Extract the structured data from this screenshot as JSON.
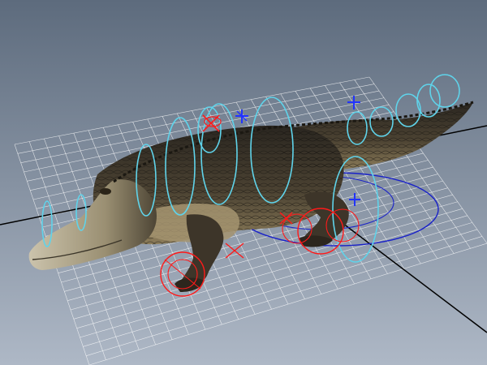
{
  "viewport": {
    "background_top": "#5d6b7d",
    "background_bottom": "#aeb8c6"
  },
  "scene": {
    "grid": {
      "line_color": "#ffffff",
      "axis_color": "#000000"
    },
    "rig": {
      "ik_color": "#ff1a1a",
      "fk_color": "#5fd3ea",
      "root_color": "#1a22c8",
      "pole_color": "#2233ff"
    },
    "model": {
      "name": "alligator",
      "skin_dark": "#2a2620",
      "skin_mid": "#4b4232",
      "belly": "#a59470",
      "snout_light": "#cbc3ac"
    }
  }
}
